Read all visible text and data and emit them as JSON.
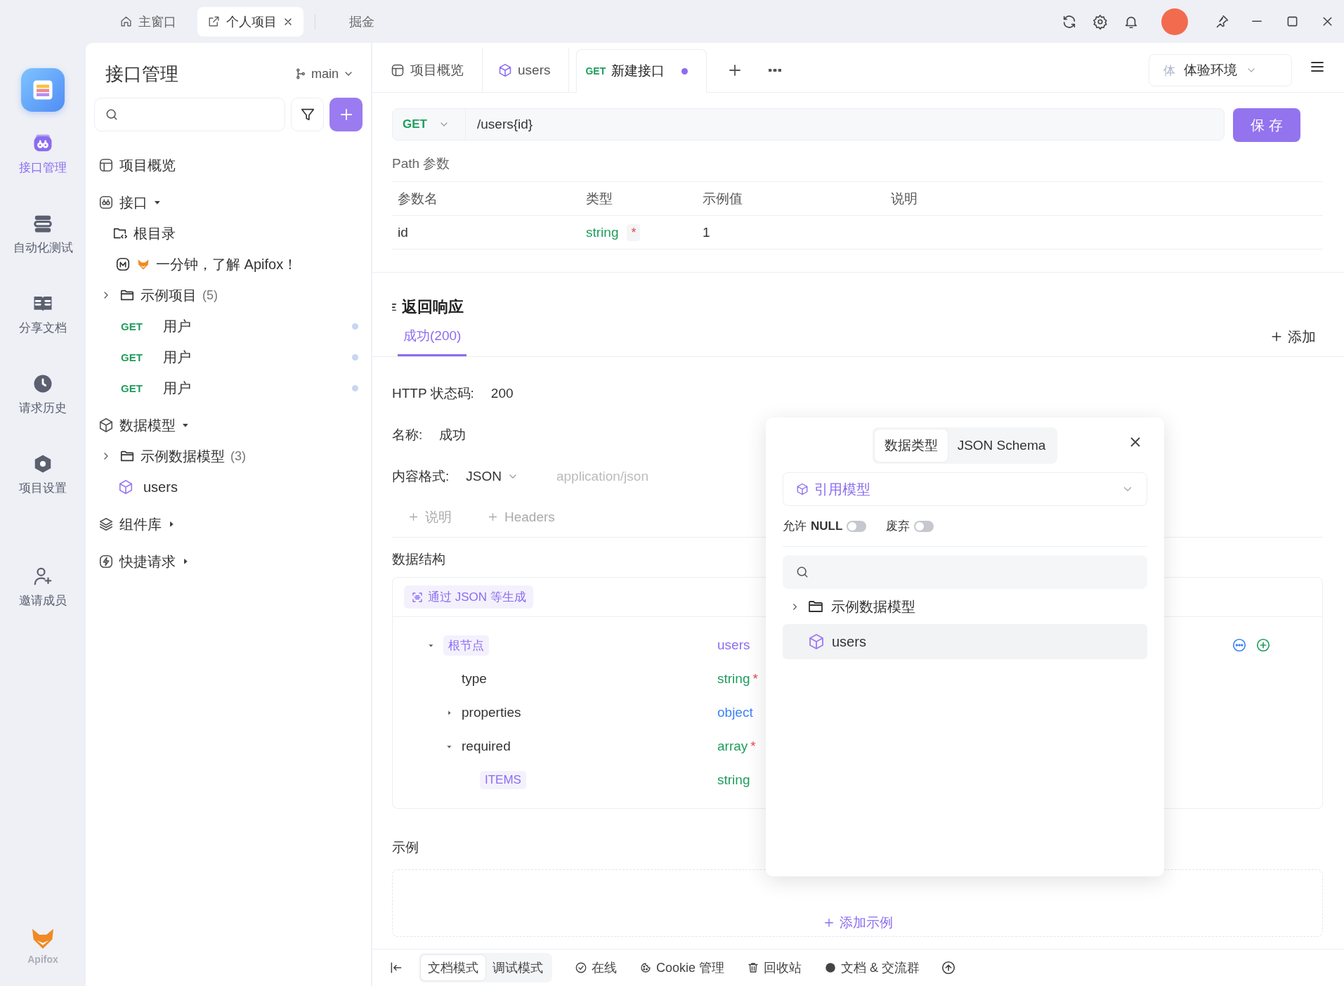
{
  "title_bar": {
    "tabs": [
      {
        "label": "主窗口",
        "selected": false,
        "closable": false
      },
      {
        "label": "个人项目",
        "selected": true,
        "closable": true
      },
      {
        "label": "掘金",
        "selected": false,
        "closable": false
      }
    ]
  },
  "nav_rail": {
    "items": [
      {
        "label": "接口管理",
        "selected": true
      },
      {
        "label": "自动化测试",
        "selected": false
      },
      {
        "label": "分享文档",
        "selected": false
      },
      {
        "label": "请求历史",
        "selected": false
      },
      {
        "label": "项目设置",
        "selected": false
      },
      {
        "label": "邀请成员",
        "selected": false
      }
    ],
    "footer": "Apifox"
  },
  "sidebar": {
    "title": "接口管理",
    "branch": "main",
    "tree": [
      {
        "kind": "page",
        "label": "项目概览"
      },
      {
        "kind": "section",
        "label": "接口",
        "expanded": true,
        "children": [
          {
            "kind": "root",
            "label": "根目录",
            "children": [
              {
                "kind": "doc",
                "label": "一分钟，了解 Apifox！"
              },
              {
                "kind": "folder",
                "label": "示例项目",
                "count": "(5)",
                "expanded": false
              },
              {
                "kind": "endpoint",
                "method": "GET",
                "label": "用户"
              },
              {
                "kind": "endpoint",
                "method": "GET",
                "label": "用户"
              },
              {
                "kind": "endpoint",
                "method": "GET",
                "label": "用户"
              }
            ]
          }
        ]
      },
      {
        "kind": "section",
        "label": "数据模型",
        "expanded": true,
        "children": [
          {
            "kind": "folder",
            "label": "示例数据模型",
            "count": "(3)",
            "expanded": false
          },
          {
            "kind": "model",
            "label": "users"
          }
        ]
      },
      {
        "kind": "section",
        "label": "组件库",
        "expanded": false
      },
      {
        "kind": "section",
        "label": "快捷请求",
        "expanded": false
      }
    ]
  },
  "tabs": [
    {
      "label": "项目概览",
      "selected": false,
      "modified": false
    },
    {
      "label": "users",
      "selected": false,
      "modified": false
    },
    {
      "method": "GET",
      "label": "新建接口",
      "selected": true,
      "modified": true
    }
  ],
  "environment": {
    "badge": "体",
    "label": "体验环境"
  },
  "request": {
    "method": "GET",
    "path": "/users{id}",
    "save": "保 存"
  },
  "path_params": {
    "title": "Path 参数",
    "columns": [
      "参数名",
      "类型",
      "示例值",
      "说明"
    ],
    "rows": [
      {
        "name": "id",
        "type": "string",
        "required_mark": "*",
        "example": "1"
      }
    ]
  },
  "response": {
    "title": "返回响应",
    "add": "添加",
    "tabs": [
      {
        "label": "成功(200)",
        "selected": true
      }
    ],
    "fields": [
      {
        "label": "HTTP 状态码:",
        "value": "200"
      },
      {
        "label": "名称:",
        "value": "成功"
      }
    ],
    "content_format": {
      "label": "内容格式:",
      "value": "JSON",
      "mime": "application/json"
    },
    "extras": [
      "说明",
      "Headers"
    ],
    "schema": {
      "title": "数据结构",
      "generate": "通过 JSON 等生成",
      "rows": [
        {
          "name": "根节点",
          "kind": "root",
          "type": "users",
          "color": "#8b6cf0",
          "expanded": true,
          "children": [
            {
              "name": "type",
              "kind": "field",
              "type": "string",
              "color": "#1f9d5c",
              "required_mark": "*"
            },
            {
              "name": "properties",
              "kind": "field",
              "type": "object",
              "color": "#3b82f6",
              "expanded": false
            },
            {
              "name": "required",
              "kind": "field",
              "type": "array",
              "color": "#1f9d5c",
              "required_mark": "*",
              "expanded": true,
              "children": [
                {
                  "name": "ITEMS",
                  "kind": "items",
                  "type": "string",
                  "color": "#1f9d5c"
                }
              ]
            }
          ]
        }
      ]
    }
  },
  "example": {
    "title": "示例",
    "add": "添加示例"
  },
  "popup": {
    "tabs": [
      {
        "label": "数据类型",
        "selected": true
      },
      {
        "label": "JSON Schema",
        "selected": false
      }
    ],
    "select": "引用模型",
    "toggles": [
      {
        "label": "允许 **NULL**",
        "on": false
      },
      {
        "label": "废弃",
        "on": false
      }
    ],
    "tree": [
      {
        "kind": "folder",
        "label": "示例数据模型",
        "expanded": false,
        "selected": false
      },
      {
        "kind": "model",
        "label": "users",
        "selected": true
      }
    ]
  },
  "status_bar": {
    "modes": [
      {
        "label": "文档模式",
        "selected": true
      },
      {
        "label": "调试模式",
        "selected": false
      }
    ],
    "items": [
      "在线",
      "Cookie 管理",
      "回收站",
      "文档 & 交流群"
    ]
  }
}
